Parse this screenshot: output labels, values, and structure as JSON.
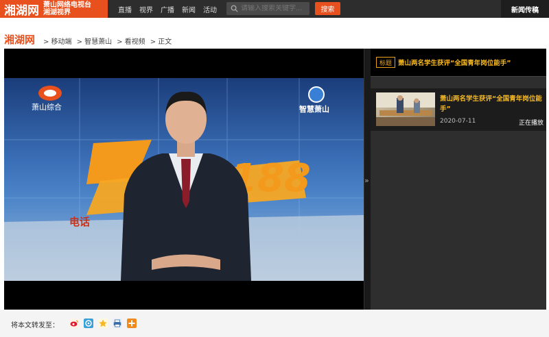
{
  "header": {
    "logo": "湘湖网",
    "logo_sub_1": "萧山网络电视台",
    "logo_sub_2": "湘湖视界",
    "nav": [
      "直播",
      "视界",
      "广播",
      "新闻",
      "活动"
    ],
    "search_placeholder": "请输入搜索关键字...",
    "search_button": "搜索",
    "right_tab": "新闻传稿"
  },
  "breadcrumb": {
    "brand": "湘湖网",
    "items": [
      "> 移动端",
      "> 智慧萧山",
      "> 看视频",
      "> 正文"
    ]
  },
  "player": {
    "video_logo_left": "萧山综合",
    "video_logo_right": "智慧萧山",
    "show_title": "热线188",
    "ticker": "电话"
  },
  "sidebar": {
    "tag": "标题",
    "title": "萧山两名学生获评“全国青年岗位能手”",
    "playlist": [
      {
        "title": "萧山两名学生获评“全国青年岗位能手”",
        "date": "2020-07-11",
        "status": "正在播放"
      }
    ]
  },
  "share": {
    "label": "将本文转发至：",
    "icons": [
      "weibo-icon",
      "tencent-icon",
      "qzone-icon",
      "print-icon",
      "more-share-icon"
    ]
  },
  "colors": {
    "accent": "#e8501d",
    "highlight": "#f5b823",
    "topbar": "#2d2d2d"
  }
}
